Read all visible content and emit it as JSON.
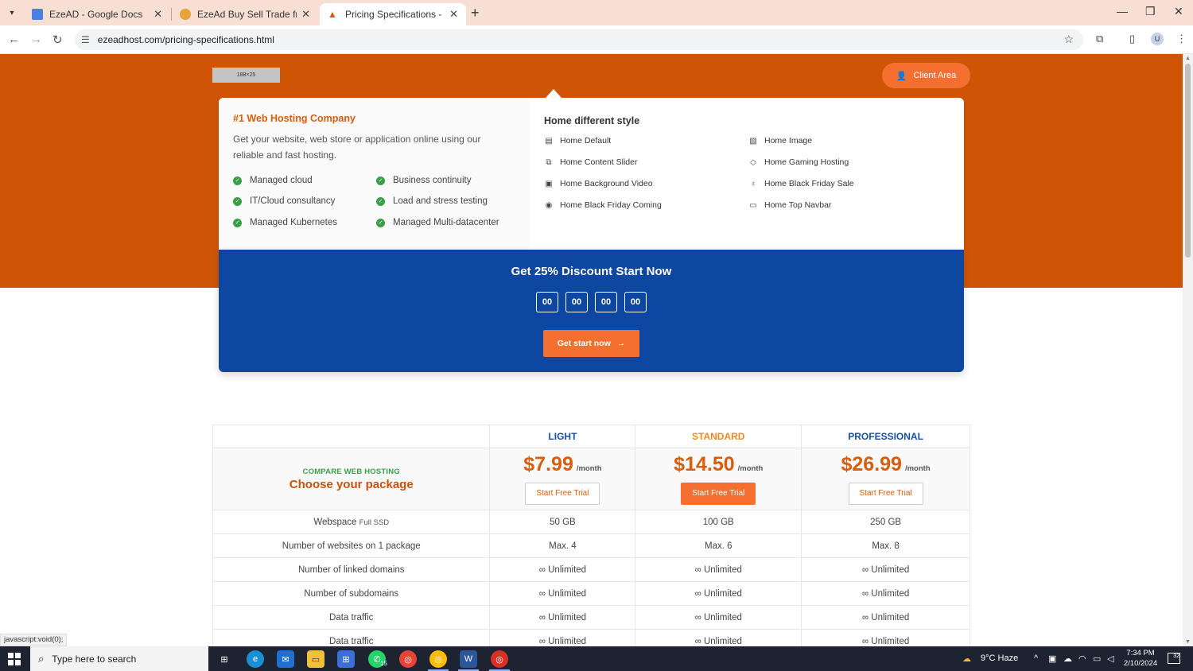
{
  "browser": {
    "tabs": [
      {
        "title": "EzeAD - Google Docs"
      },
      {
        "title": "EzeAd Buy Sell Trade from Auct"
      },
      {
        "title": "Pricing Specifications - Modern"
      }
    ],
    "url": "ezeadhost.com/pricing-specifications.html",
    "avatar_letter": "U"
  },
  "header": {
    "logo_text": "188×25",
    "client_area_label": "Client Area"
  },
  "mega_menu": {
    "left_title": "#1 Web Hosting Company",
    "left_text": "Get your website, web store or application online using our reliable and fast hosting.",
    "features": [
      "Managed cloud",
      "Business continuity",
      "IT/Cloud consultancy",
      "Load and stress testing",
      "Managed Kubernetes",
      "Managed Multi-datacenter"
    ],
    "right_title": "Home different style",
    "links": [
      "Home Default",
      "Home Image",
      "Home Content Slider",
      "Home Gaming Hosting",
      "Home Background Video",
      "Home Black Friday Sale",
      "Home Black Friday Coming",
      "Home Top Navbar"
    ]
  },
  "promo": {
    "title": "Get 25% Discount Start Now",
    "countdown": [
      "00",
      "00",
      "00",
      "00"
    ],
    "button_label": "Get start now"
  },
  "pricing": {
    "compare_label": "COMPARE WEB HOSTING",
    "choose_label": "Choose your package",
    "plans": [
      {
        "name": "LIGHT",
        "name_color": "#1a4fa8",
        "price": "$7.99",
        "period": "/month",
        "cta": "Start Free Trial"
      },
      {
        "name": "STANDARD",
        "name_color": "#f08a24",
        "price": "$14.50",
        "period": "/month",
        "cta": "Start Free Trial"
      },
      {
        "name": "PROFESSIONAL",
        "name_color": "#1a4fa8",
        "price": "$26.99",
        "period": "/month",
        "cta": "Start Free Trial"
      }
    ],
    "rows": [
      {
        "label": "Webspace",
        "note": "Full SSD",
        "values": [
          "50 GB",
          "100 GB",
          "250 GB"
        ]
      },
      {
        "label": "Number of websites on 1 package",
        "note": "",
        "values": [
          "Max. 4",
          "Max. 6",
          "Max. 8"
        ]
      },
      {
        "label": "Number of linked domains",
        "note": "",
        "values": [
          "∞ Unlimited",
          "∞ Unlimited",
          "∞ Unlimited"
        ]
      },
      {
        "label": "Number of subdomains",
        "note": "",
        "values": [
          "∞ Unlimited",
          "∞ Unlimited",
          "∞ Unlimited"
        ]
      },
      {
        "label": "Data traffic",
        "note": "",
        "values": [
          "∞ Unlimited",
          "∞ Unlimited",
          "∞ Unlimited"
        ]
      },
      {
        "label": "Data traffic",
        "note": "",
        "values": [
          "∞ Unlimited",
          "∞ Unlimited",
          "∞ Unlimited"
        ]
      }
    ]
  },
  "status_text": "javascript:void(0);",
  "taskbar": {
    "search_placeholder": "Type here to search",
    "whatsapp_badge": "15",
    "weather": "9°C  Haze",
    "time": "7:34 PM",
    "date": "2/10/2024",
    "notification_count": "32"
  },
  "colors": {
    "brand_orange": "#cf5506",
    "accent_orange": "#f46f30",
    "promo_blue": "#0d47a1",
    "check_green": "#3aa048"
  }
}
